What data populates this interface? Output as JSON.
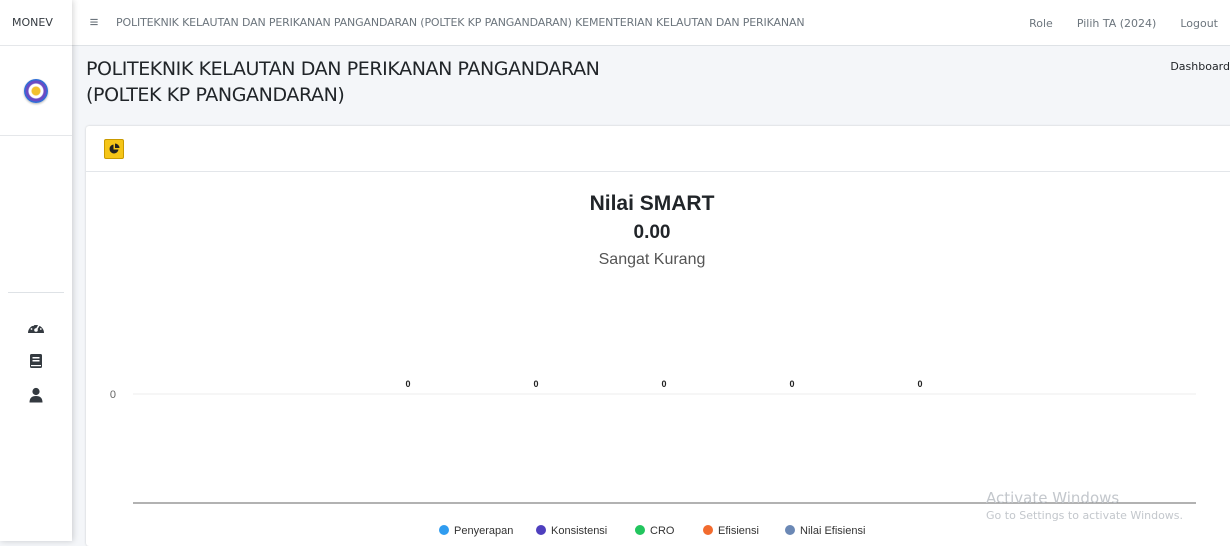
{
  "sidebar": {
    "brand": "MONEV",
    "nav": [
      {
        "icon": "dashboard-gauge-icon"
      },
      {
        "icon": "book-icon"
      },
      {
        "icon": "user-icon"
      }
    ]
  },
  "topbar": {
    "menu_icon": "≡",
    "title": "POLITEKNIK KELAUTAN DAN PERIKANAN PANGANDARAN (POLTEK KP PANGANDARAN) KEMENTERIAN KELAUTAN DAN PERIKANAN",
    "role_label": "Role",
    "ta_label": "Pilih TA (2024)",
    "logout_label": "Logout"
  },
  "header": {
    "title_line1": "POLITEKNIK KELAUTAN DAN PERIKANAN PANGANDARAN",
    "title_line2": "(POLTEK KP PANGANDARAN)",
    "breadcrumb": "Dashboard"
  },
  "colors": {
    "accent_yellow": "#f5c518",
    "penyerapan": "#2f9cf0",
    "konsistensi": "#4e3fbe",
    "cro": "#22c55e",
    "efisiensi": "#f26b2e",
    "nilai_efisiensi": "#6b88b5"
  },
  "chart_data": {
    "type": "bar",
    "title": "Nilai SMART",
    "subtitle_value": "0.00",
    "subtitle_text": "Sangat Kurang",
    "y_tick": "0",
    "series": [
      {
        "name": "Penyerapan",
        "value": 0,
        "label": "0"
      },
      {
        "name": "Konsistensi",
        "value": 0,
        "label": "0"
      },
      {
        "name": "CRO",
        "value": 0,
        "label": "0"
      },
      {
        "name": "Efisiensi",
        "value": 0,
        "label": "0"
      },
      {
        "name": "Nilai Efisiensi",
        "value": 0,
        "label": "0"
      }
    ],
    "legend_position": "bottom"
  },
  "watermark": {
    "line1": "Activate Windows",
    "line2": "Go to Settings to activate Windows."
  }
}
